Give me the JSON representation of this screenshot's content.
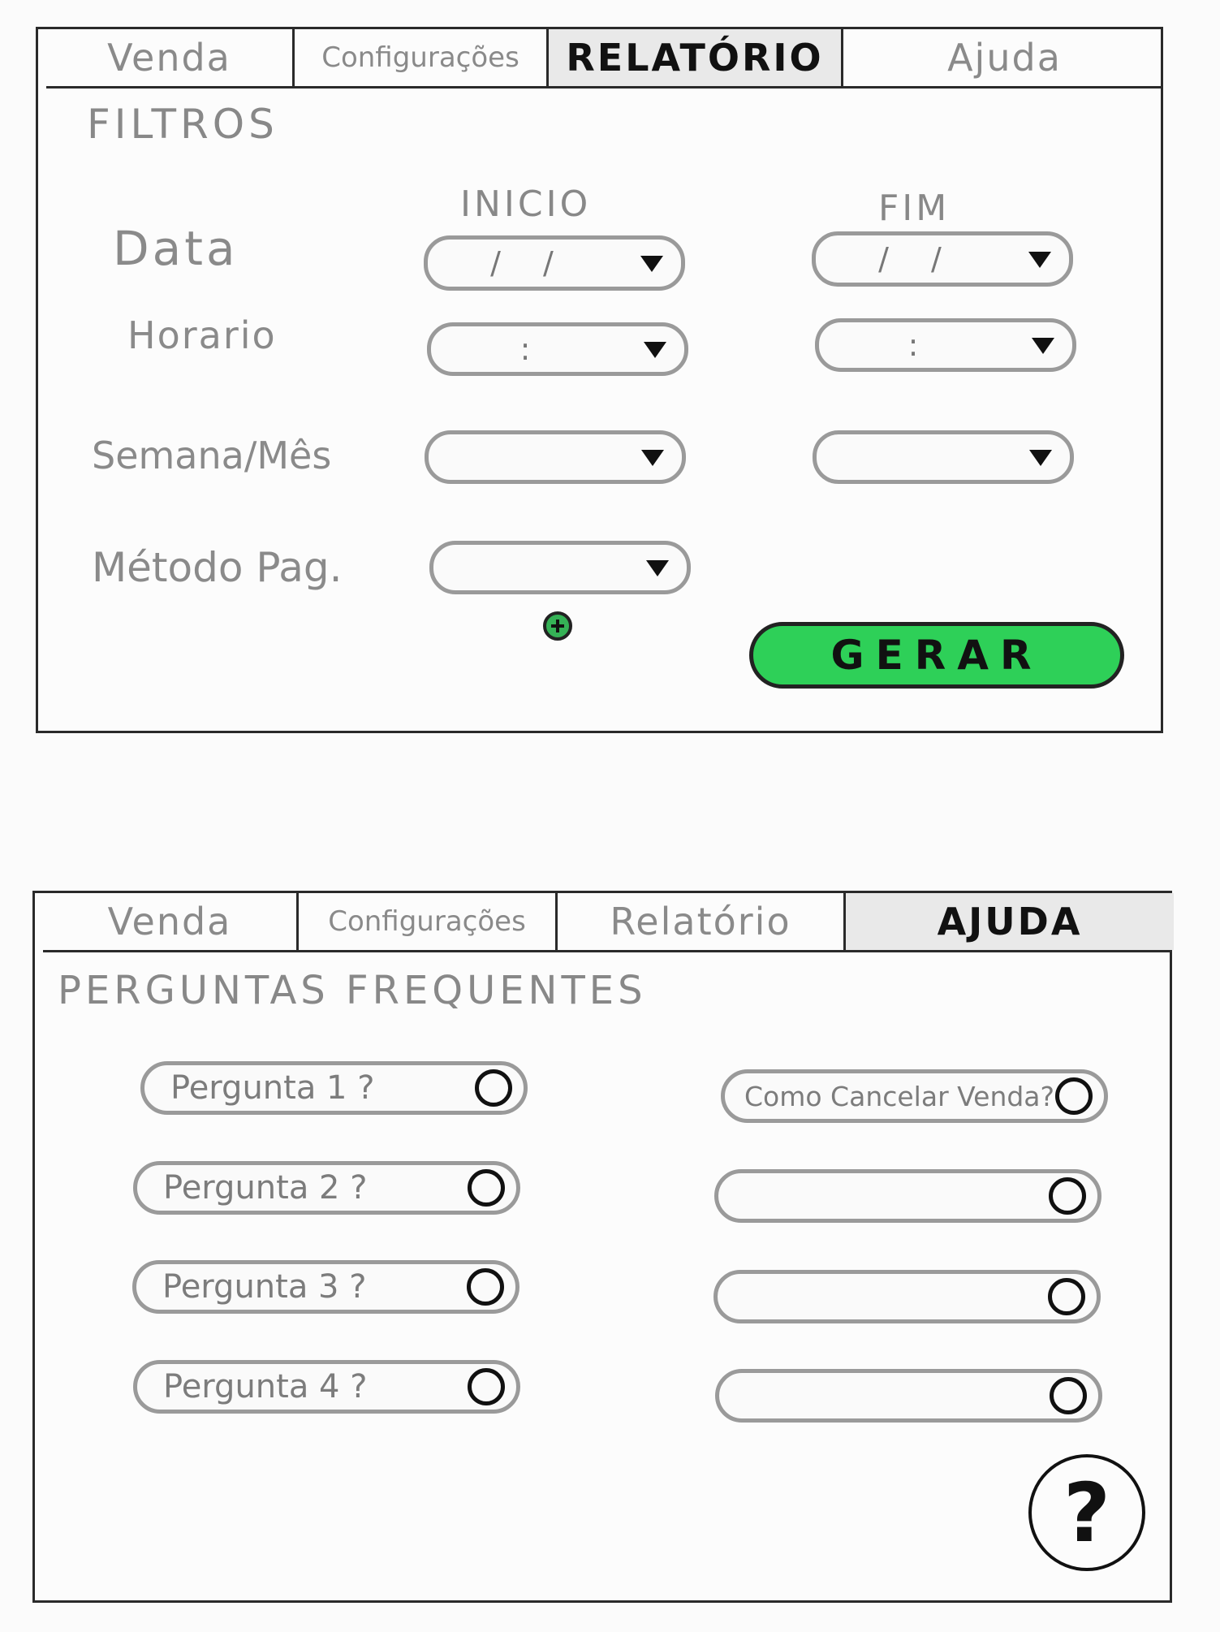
{
  "report": {
    "tabs": [
      "Venda",
      "Configurações",
      "RELATÓRIO",
      "Ajuda"
    ],
    "section_title": "FILTROS",
    "col_start": "INICIO",
    "col_end": "FIM",
    "rows": {
      "date": "Data",
      "time": "Horario",
      "week_month": "Semana/Mês",
      "payment": "Método Pag."
    },
    "date_mask": "/ /",
    "time_mask": ":",
    "add_icon": "plus-circle-icon",
    "generate": "GERAR",
    "generate_color": "#2ed058"
  },
  "help": {
    "tabs": [
      "Venda",
      "Configurações",
      "Relatório",
      "AJUDA"
    ],
    "section_title": "PERGUNTAS FREQUENTES",
    "left_questions": [
      "Pergunta 1 ?",
      "Pergunta 2 ?",
      "Pergunta 3 ?",
      "Pergunta 4 ?"
    ],
    "right_questions": [
      "Como Cancelar Venda?",
      "",
      "",
      ""
    ],
    "help_button": "?"
  }
}
